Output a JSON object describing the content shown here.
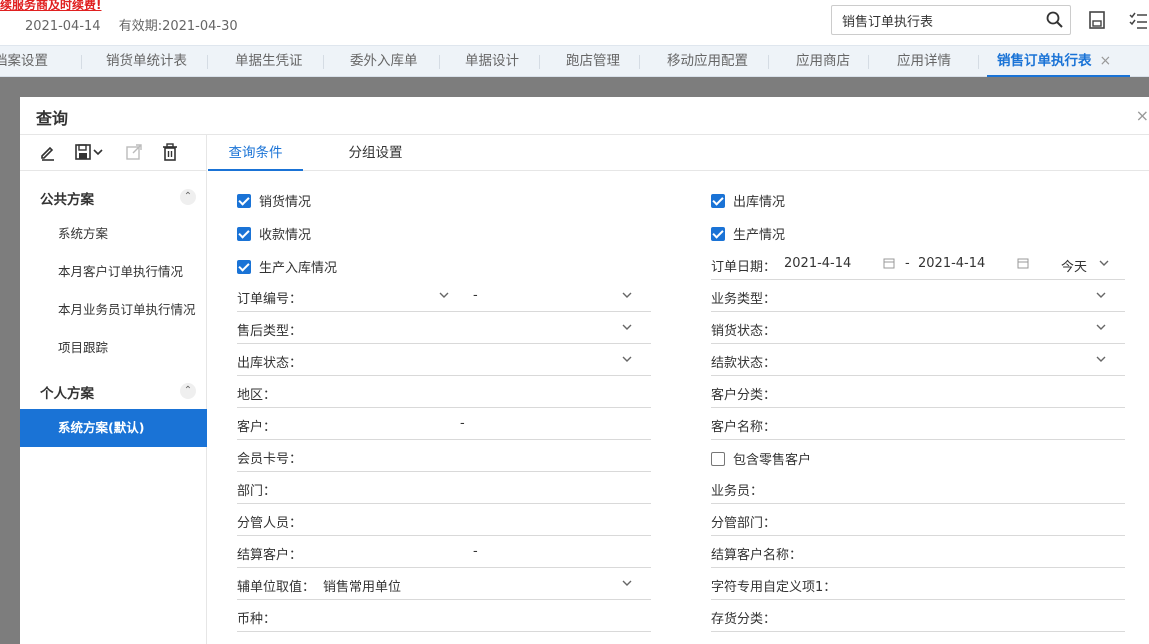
{
  "header": {
    "warning": "续服务商及时续费!",
    "date": "2021-04-14",
    "expiry": "有效期:2021-04-30",
    "search_value": "销售订单执行表"
  },
  "tabs": [
    {
      "label": "档案设置"
    },
    {
      "label": "销货单统计表"
    },
    {
      "label": "单据生凭证"
    },
    {
      "label": "委外入库单"
    },
    {
      "label": "单据设计"
    },
    {
      "label": "跑店管理"
    },
    {
      "label": "移动应用配置"
    },
    {
      "label": "应用商店"
    },
    {
      "label": "应用详情"
    },
    {
      "label": "销售订单执行表",
      "close": "×"
    }
  ],
  "dialog": {
    "title": "查询",
    "close": "×"
  },
  "left": {
    "public_group": "公共方案",
    "public_items": [
      "系统方案",
      "本月客户订单执行情况",
      "本月业务员订单执行情况",
      "项目跟踪"
    ],
    "personal_group": "个人方案",
    "personal_items": [
      "系统方案(默认)"
    ]
  },
  "subtabs": [
    "查询条件",
    "分组设置"
  ],
  "checks": {
    "sales": "销货情况",
    "receipt": "收款情况",
    "prod_in": "生产入库情况",
    "outbound": "出库情况",
    "production": "生产情况",
    "retail": "包含零售客户"
  },
  "fields": {
    "order_no": "订单编号：",
    "after_sale": "售后类型：",
    "out_status": "出库状态：",
    "region": "地区：",
    "customer": "客户：",
    "member_card": "会员卡号：",
    "dept": "部门：",
    "manager": "分管人员：",
    "settle_cust": "结算客户：",
    "aux_unit": "辅单位取值：",
    "aux_unit_val": "销售常用单位",
    "currency": "币种：",
    "order_date": "订单日期：",
    "date_from": "2021-4-14",
    "date_to": "2021-4-14",
    "date_preset": "今天",
    "biz_type": "业务类型：",
    "sales_status": "销货状态：",
    "settle_status": "结款状态：",
    "cust_class": "客户分类：",
    "cust_name": "客户名称：",
    "salesman": "业务员：",
    "mgr_dept": "分管部门：",
    "settle_cust_name": "结算客户名称：",
    "custom1": "字符专用自定义项1：",
    "stock_class": "存货分类：",
    "dash": "-"
  }
}
